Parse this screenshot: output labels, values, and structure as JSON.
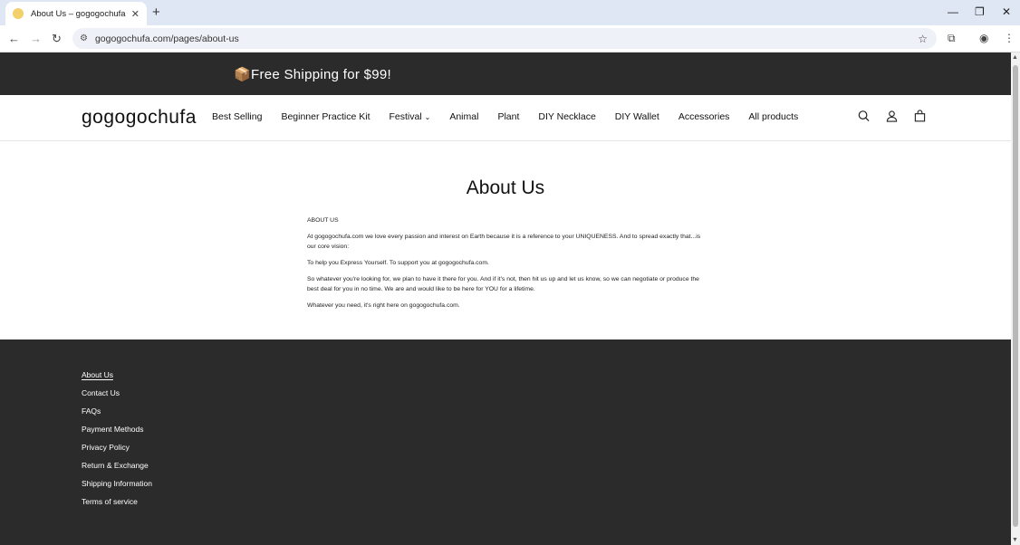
{
  "browser": {
    "tab_title": "About Us – gogogochufa",
    "url": "gogogochufa.com/pages/about-us"
  },
  "announcement": "📦Free Shipping for $99!",
  "header": {
    "logo": "gogogochufa",
    "menu": [
      "Best Selling",
      "Beginner Practice Kit",
      "Festival",
      "Animal",
      "Plant",
      "DIY Necklace",
      "DIY Wallet",
      "Accessories",
      "All products"
    ]
  },
  "content": {
    "title": "About Us",
    "paragraphs": [
      "ABOUT US",
      "At gogogochufa.com  we love every passion and interest on Earth because it is a reference to your UNIQUENESS. And to spread exactly that...is our core vision:",
      "To help you Express Yourself. To support you at gogogochufa.com.",
      "So whatever you're looking for, we plan to have it there for you. And if it's not, then hit us up and let us know, so we can negotiate or produce the best deal for you in no time. We are and would like to be here for YOU for a lifetime.",
      "Whatever you need, it's right here on gogogochufa.com."
    ]
  },
  "footer": {
    "links": [
      "About Us",
      "Contact Us",
      "FAQs",
      "Payment Methods",
      "Privacy Policy",
      "Return & Exchange",
      "Shipping Information",
      "Terms of service"
    ]
  }
}
